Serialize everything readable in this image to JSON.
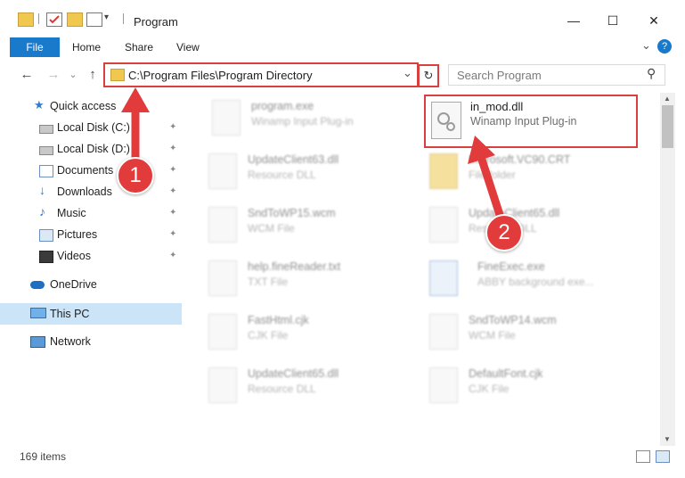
{
  "window": {
    "title": "Program",
    "minimize": "—",
    "maximize": "☐",
    "close": "✕"
  },
  "ribbon": {
    "file": "File",
    "home": "Home",
    "share": "Share",
    "view": "View",
    "expand": "⌄",
    "help": "?"
  },
  "nav": {
    "back": "←",
    "forward": "→",
    "recent": "⌄",
    "up": "↑",
    "address": "C:\\Program Files\\Program Directory",
    "address_dropdown": "⌄",
    "refresh": "↻",
    "search_placeholder": "Search Program",
    "search_icon": "⚲"
  },
  "sidebar": {
    "items": [
      {
        "label": "Quick access",
        "icon": "star-icon",
        "pinned": false
      },
      {
        "label": "Local Disk (C:)",
        "icon": "drive-icon",
        "pinned": true
      },
      {
        "label": "Local Disk (D:)",
        "icon": "drive-icon",
        "pinned": true
      },
      {
        "label": "Documents",
        "icon": "documents-icon",
        "pinned": true
      },
      {
        "label": "Downloads",
        "icon": "download-icon",
        "pinned": true
      },
      {
        "label": "Music",
        "icon": "music-icon",
        "pinned": true
      },
      {
        "label": "Pictures",
        "icon": "pictures-icon",
        "pinned": true
      },
      {
        "label": "Videos",
        "icon": "videos-icon",
        "pinned": true
      },
      {
        "label": "OneDrive",
        "icon": "cloud-icon"
      },
      {
        "label": "This PC",
        "icon": "computer-icon",
        "selected": true
      },
      {
        "label": "Network",
        "icon": "network-icon"
      }
    ],
    "pin_glyph": "📌"
  },
  "files": [
    {
      "name": "program.exe",
      "type": "Winamp Input Plug-in"
    },
    {
      "name": "in_mod.dll",
      "type": "Winamp Input Plug-in",
      "highlighted": true
    },
    {
      "name": "UpdateClient63.dll",
      "type": "Resource DLL"
    },
    {
      "name": "Microsoft.VC90.CRT",
      "type": "File folder"
    },
    {
      "name": "SndToWP15.wcm",
      "type": "WCM File"
    },
    {
      "name": "UpdateClient65.dll",
      "type": "Resource DLL"
    },
    {
      "name": "help.fineReader.txt",
      "type": "TXT File"
    },
    {
      "name": "FineExec.exe",
      "type": "ABBY background exe..."
    },
    {
      "name": "FastHtml.cjk",
      "type": "CJK File"
    },
    {
      "name": "SndToWP14.wcm",
      "type": "WCM File"
    },
    {
      "name": "UpdateClient65.dll",
      "type": "Resource DLL"
    },
    {
      "name": "DefaultFont.cjk",
      "type": "CJK File"
    }
  ],
  "status": {
    "count": "169 items"
  },
  "callouts": {
    "one": "1",
    "two": "2"
  },
  "colors": {
    "accent": "#1979ca",
    "annotation_red": "#d84040",
    "selection": "#cce4f7"
  }
}
